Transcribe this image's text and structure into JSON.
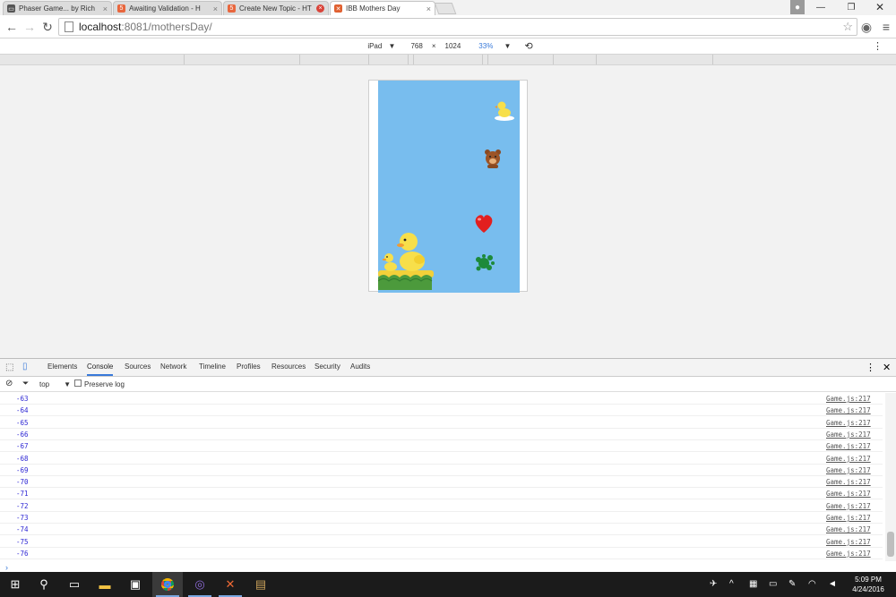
{
  "browser": {
    "tabs": [
      {
        "title": "Phaser Game... by Rich",
        "favicon_color": "#555555"
      },
      {
        "title": "Awaiting Validation - H",
        "favicon_color": "#e8663d"
      },
      {
        "title": "Create New Topic - HT",
        "favicon_color": "#e8663d"
      },
      {
        "title": "IBB Mothers Day",
        "favicon_color": "#e06030"
      }
    ],
    "url_host": "localhost",
    "url_path": ":8081/mothersDay/"
  },
  "device_toolbar": {
    "device": "iPad",
    "width": "768",
    "times": "×",
    "height": "1024",
    "zoom": "33%"
  },
  "devtools": {
    "tabs": [
      "Elements",
      "Console",
      "Sources",
      "Network",
      "Timeline",
      "Profiles",
      "Resources",
      "Security",
      "Audits"
    ],
    "active_tab": "Console",
    "context": "top",
    "preserve_log": "Preserve log",
    "log_source": "Game.js:217",
    "log_rows": [
      "-63",
      "-64",
      "-65",
      "-66",
      "-67",
      "-68",
      "-69",
      "-70",
      "-71",
      "-72",
      "-73",
      "-74",
      "-75",
      "-76"
    ],
    "prompt": "›"
  },
  "taskbar": {
    "time": "5:09 PM",
    "date": "4/24/2016"
  },
  "colors": {
    "game_sky": "#78bdee",
    "console_value": "#2f28d4",
    "accent": "#3879d9"
  }
}
